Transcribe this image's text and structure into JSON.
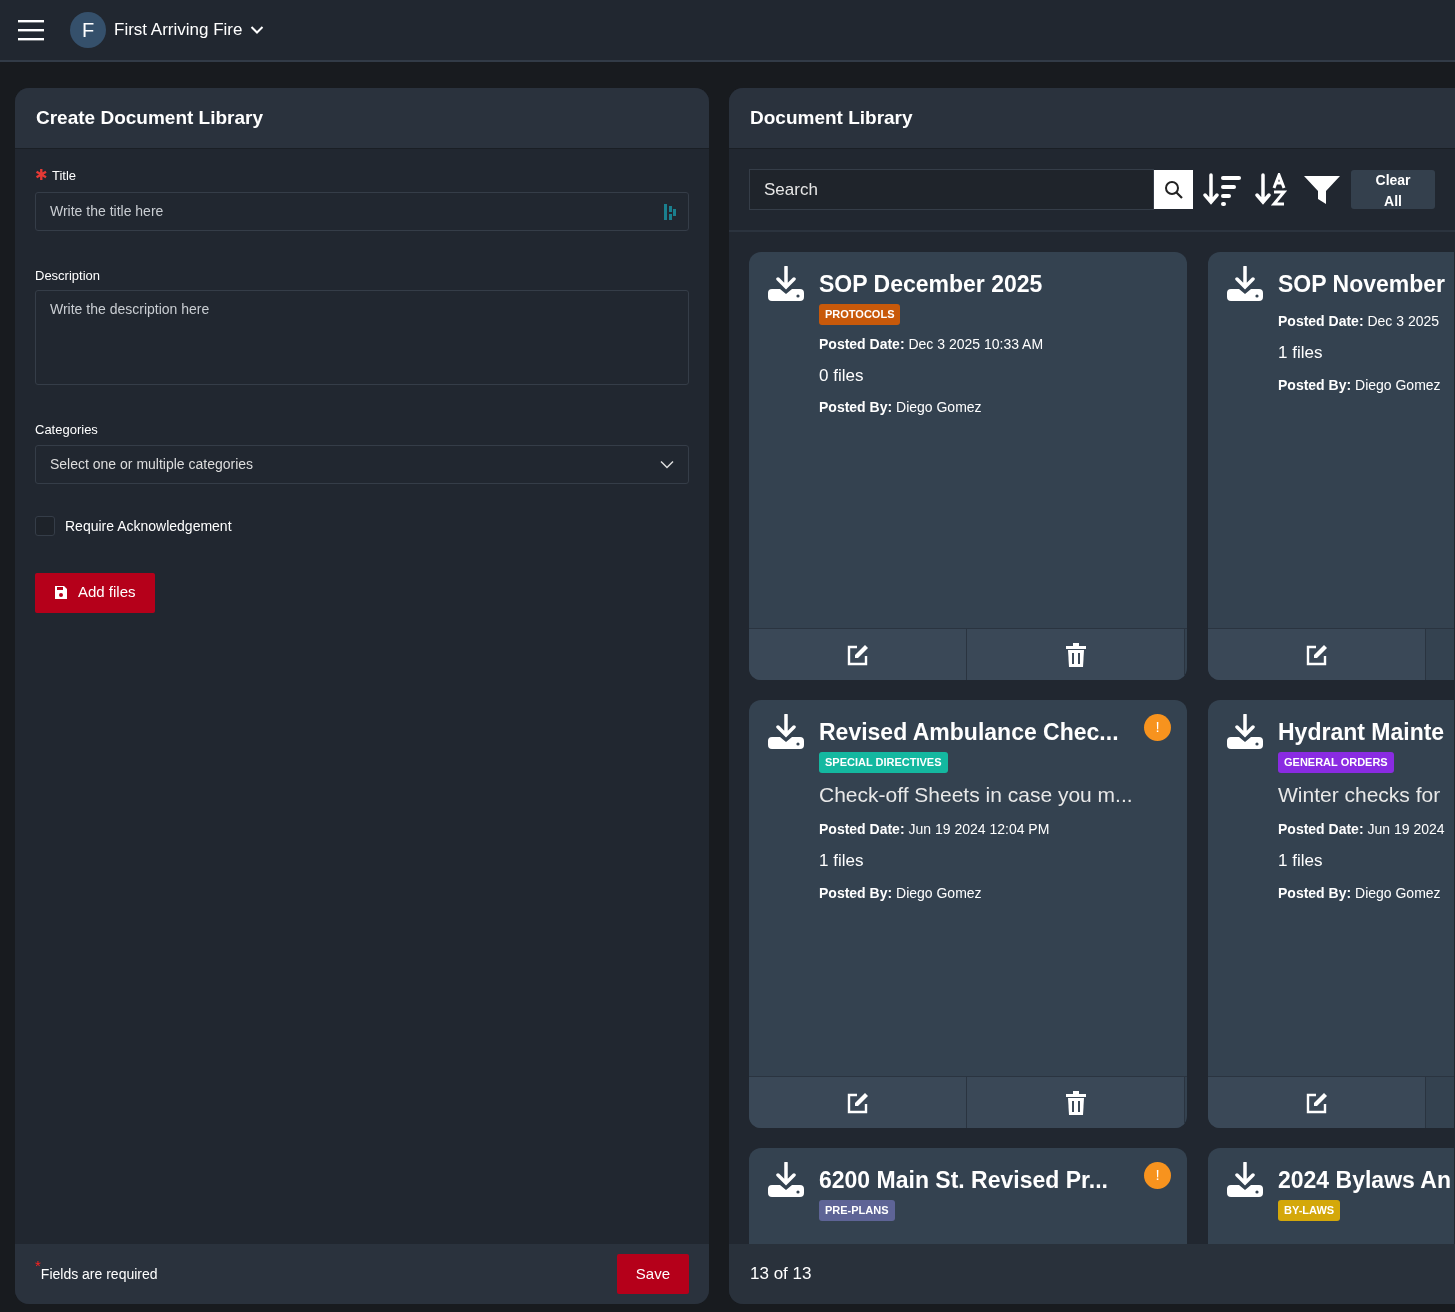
{
  "navbar": {
    "avatar_letter": "F",
    "org_name": "First Arriving Fire"
  },
  "create_form": {
    "title": "Create Document Library",
    "fields": [
      {
        "kind": "text",
        "label": "Title",
        "required_mark": "✱",
        "placeholder": "Write the title here"
      },
      {
        "kind": "textarea",
        "label": "Description",
        "placeholder": "Write the description here"
      },
      {
        "kind": "select",
        "label": "Categories",
        "placeholder": "Select one or multiple categories"
      },
      {
        "kind": "checkbox",
        "label": "Require Acknowledgement",
        "checked": false
      }
    ],
    "add_files_button": "Add files",
    "footer_note": "$^{*}$Fields are required",
    "save_button": "Save"
  },
  "library": {
    "title": "Document Library",
    "search": {
      "placeholder": "Search"
    },
    "clear_button": "Clear All",
    "cards": [
      {
        "title": "SOP December 2025",
        "category": "PROTOCOLS",
        "color": "#c8590a",
        "posted_date": "**Posted Date:** Dec 3 2025 10:33 AM",
        "files": "0 files",
        "posted_by": "**Posted By:** Diego Gomez",
        "actions": [
          {
            "kind": "edit"
          },
          {
            "kind": "delete"
          }
        ]
      },
      {
        "title": "SOP November",
        "posted_date": "**Posted Date:** Dec 3 2025",
        "files": "1 files",
        "posted_by": "**Posted By:** Diego Gomez",
        "actions": [
          {
            "kind": "edit"
          }
        ]
      },
      {
        "title": "Revised Ambulance Chec...",
        "alert_mark": "!",
        "category": "SPECIAL DIRECTIVES",
        "color": "#14b8a0",
        "description": "Check-off Sheets in case you m...",
        "posted_date": "**Posted Date:** Jun 19 2024 12:04 PM",
        "files": "1 files",
        "posted_by": "**Posted By:** Diego Gomez",
        "actions": [
          {
            "kind": "edit"
          },
          {
            "kind": "delete"
          }
        ]
      },
      {
        "title": "Hydrant Mainte",
        "category": "GENERAL ORDERS",
        "color": "#8a2be2",
        "description": "Winter checks for",
        "posted_date": "**Posted Date:** Jun 19 2024",
        "files": "1 files",
        "posted_by": "**Posted By:** Diego Gomez",
        "actions": [
          {
            "kind": "edit"
          }
        ]
      },
      {
        "title": "6200 Main St. Revised Pr...",
        "alert_mark": "!",
        "category": "PRE-PLANS",
        "color": "#5e6496"
      },
      {
        "title": "2024 Bylaws An",
        "category": "BY-LAWS",
        "color": "#d4a80a"
      }
    ],
    "count": "13 of 13"
  }
}
